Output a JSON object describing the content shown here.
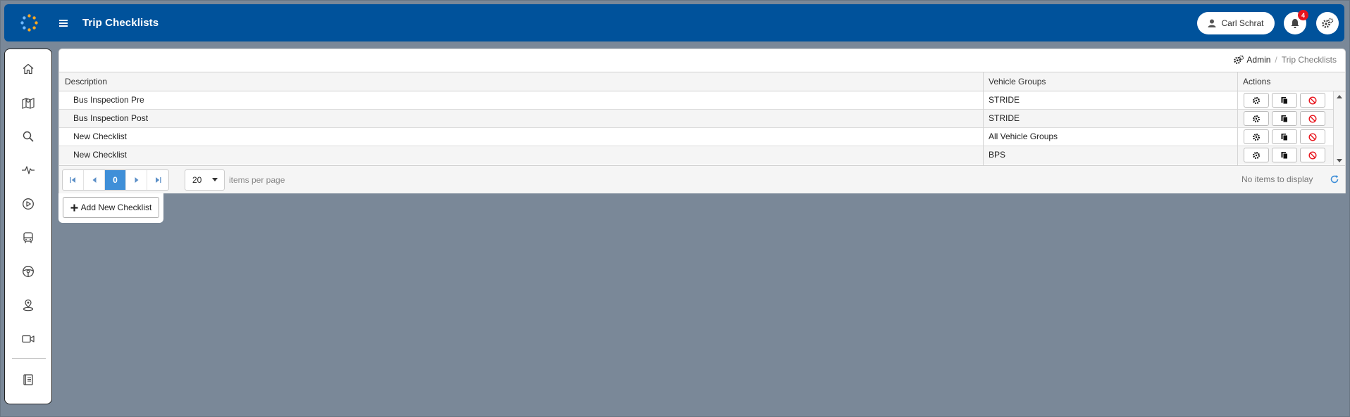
{
  "header": {
    "title": "Trip Checklists",
    "user_name": "Carl Schrat",
    "notification_count": "4"
  },
  "sidebar": {
    "items": [
      "home-icon",
      "map-icon",
      "search-icon",
      "pulse-icon",
      "play-icon",
      "bus-icon",
      "steering-wheel-icon",
      "location-pin-icon",
      "video-camera-icon",
      "book-icon"
    ]
  },
  "breadcrumb": {
    "admin": "Admin",
    "current": "Trip Checklists"
  },
  "grid": {
    "columns": [
      "Description",
      "Vehicle Groups",
      "Actions"
    ],
    "rows": [
      {
        "description": "Bus Inspection Pre",
        "vehicle_groups": "STRIDE"
      },
      {
        "description": "Bus Inspection Post",
        "vehicle_groups": "STRIDE"
      },
      {
        "description": "New Checklist",
        "vehicle_groups": "All Vehicle Groups"
      },
      {
        "description": "New Checklist",
        "vehicle_groups": "BPS"
      }
    ]
  },
  "pager": {
    "current_page": "0",
    "page_size": "20",
    "items_per_page_label": "items per page",
    "status": "No items to display"
  },
  "add_button_label": "Add New Checklist",
  "colors": {
    "header_bg": "#00529b",
    "page_bg": "#7a8898",
    "active_page": "#3f8fd8",
    "delete_red": "#e8141c"
  }
}
